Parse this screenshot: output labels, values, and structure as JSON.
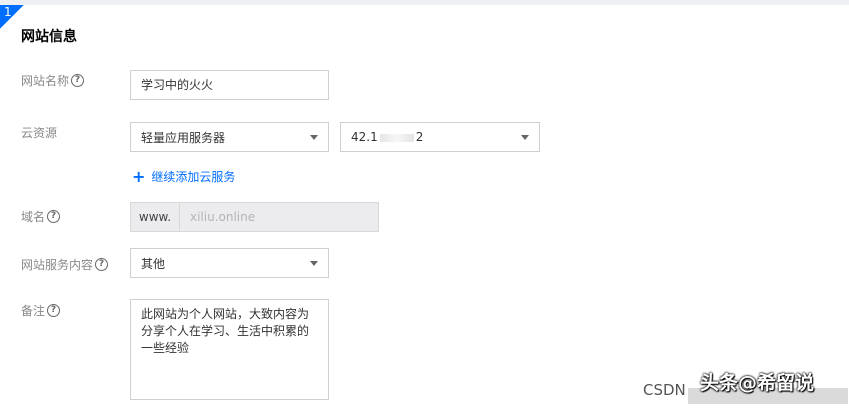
{
  "step": {
    "number": "1"
  },
  "section": {
    "title": "网站信息"
  },
  "site_name": {
    "label": "网站名称",
    "value": "学习中的火火"
  },
  "cloud": {
    "label": "云资源",
    "type_value": "轻量应用服务器",
    "ip_prefix": "42.1",
    "ip_suffix": "2",
    "add_link": "继续添加云服务"
  },
  "domain": {
    "label": "域名",
    "prefix": "www.",
    "value": "xiliu.online"
  },
  "content": {
    "label": "网站服务内容",
    "value": "其他"
  },
  "remark": {
    "label": "备注",
    "value": "此网站为个人网站，大致内容为分享个人在学习、生活中积累的一些经验"
  },
  "watermarks": {
    "csdn": "CSDN",
    "main": "头条@希留说"
  },
  "colors": {
    "accent": "#006eff",
    "label": "#888888",
    "border": "#d0d0d0",
    "disabled_bg": "#ececee"
  }
}
